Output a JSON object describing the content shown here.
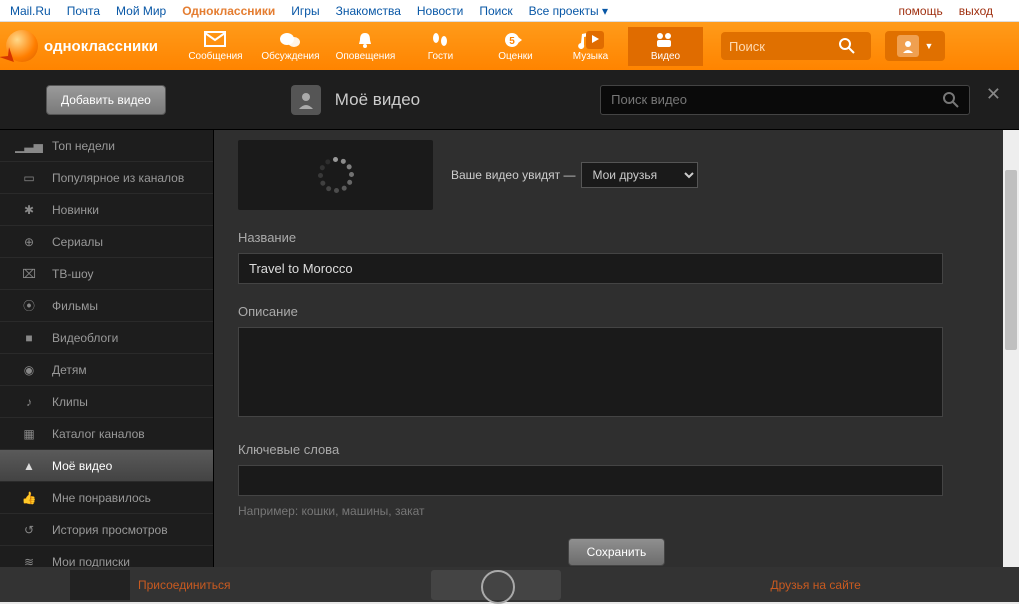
{
  "topbar": {
    "links": [
      "Mail.Ru",
      "Почта",
      "Мой Мир",
      "Одноклассники",
      "Игры",
      "Знакомства",
      "Новости",
      "Поиск",
      "Все проекты ▾"
    ],
    "active_index": 3,
    "help": "помощь",
    "exit": "выход"
  },
  "header": {
    "brand": "одноклассники",
    "nav": [
      "Сообщения",
      "Обсуждения",
      "Оповещения",
      "Гости",
      "Оценки",
      "Музыка",
      "Видео"
    ],
    "search_placeholder": "Поиск"
  },
  "video_modal": {
    "add_button": "Добавить видео",
    "title": "Моё видео",
    "search_placeholder": "Поиск видео",
    "sidebar": [
      "Топ недели",
      "Популярное из каналов",
      "Новинки",
      "Сериалы",
      "ТВ-шоу",
      "Фильмы",
      "Видеоблоги",
      "Детям",
      "Клипы",
      "Каталог каналов",
      "Моё видео",
      "Мне понравилось",
      "История просмотров",
      "Мои подписки"
    ],
    "sidebar_active_index": 10,
    "visibility_label": "Ваше видео увидят —",
    "visibility_value": "Мои друзья",
    "fields": {
      "name_label": "Название",
      "name_value": "Travel to Morocco",
      "desc_label": "Описание",
      "desc_value": "",
      "tags_label": "Ключевые слова",
      "tags_value": "",
      "tags_hint": "Например: кошки, машины, закат"
    },
    "save_button": "Сохранить"
  },
  "bg": {
    "join": "Присоединиться",
    "friends": "Друзья на сайте"
  }
}
